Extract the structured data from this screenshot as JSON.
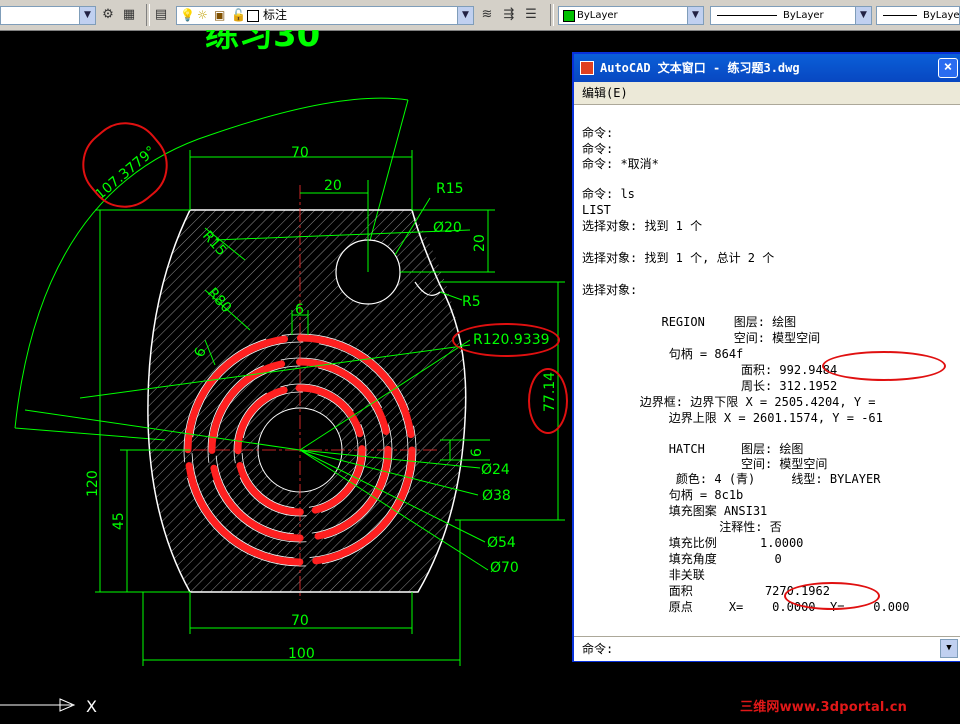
{
  "toolbar": {
    "layer_name": "标注",
    "color": "ByLayer",
    "linetype": "ByLayer",
    "lineweight": "ByLaye",
    "layer_color_swatch": "#ffffff",
    "color_swatch": "#00c000"
  },
  "drawing": {
    "title_partial": "练习30",
    "colors": {
      "outline": "#ffffff",
      "dimension": "#00ff00",
      "hatch": "#b0b0b0",
      "hole": "#ff2020",
      "center": "#ff3030",
      "annotation": "#ff0000"
    },
    "dims": {
      "top_width": "70",
      "hole_offset": "20",
      "r15_top": "R15",
      "d20": "Ø20",
      "h20": "20",
      "r5": "R5",
      "r15_left": "R15",
      "r80": "R80",
      "r120": "R120.9339",
      "angle": "107.3779°",
      "h77": "77.14",
      "six_top": "6",
      "six_right": "6",
      "six_left": "6",
      "d24": "Ø24",
      "d38": "Ø38",
      "d54": "Ø54",
      "d70": "Ø70",
      "h120": "120",
      "h45": "45",
      "bottom_70": "70",
      "bottom_100": "100"
    },
    "ucs_x": "X"
  },
  "textwin": {
    "title": "AutoCAD 文本窗口 - 练习题3.dwg",
    "menu": "编辑(E)",
    "lines": [
      "命令:",
      "命令:",
      "命令: *取消*",
      "",
      "命令: ls",
      "LIST",
      "选择对象: 找到 1 个",
      "",
      "选择对象: 找到 1 个, 总计 2 个",
      "",
      "选择对象:",
      "",
      "           REGION    图层: 绘图",
      "                     空间: 模型空间",
      "            句柄 = 864f",
      "                      面积: 992.9484",
      "                      周长: 312.1952",
      "        边界框: 边界下限 X = 2505.4204, Y =",
      "            边界上限 X = 2601.1574, Y = -61",
      "",
      "            HATCH     图层: 绘图",
      "                      空间: 模型空间",
      "             颜色: 4 (青)     线型: BYLAYER",
      "            句柄 = 8c1b",
      "            填充图案 ANSI31",
      "                   注释性: 否",
      "            填充比例      1.0000",
      "            填充角度        0",
      "            非关联",
      "            面积          7270.1962",
      "            原点     X=    0.0000  Y=    0.000"
    ],
    "command_prompt": "命令:"
  },
  "watermark": "三维网www.3dportal.cn"
}
